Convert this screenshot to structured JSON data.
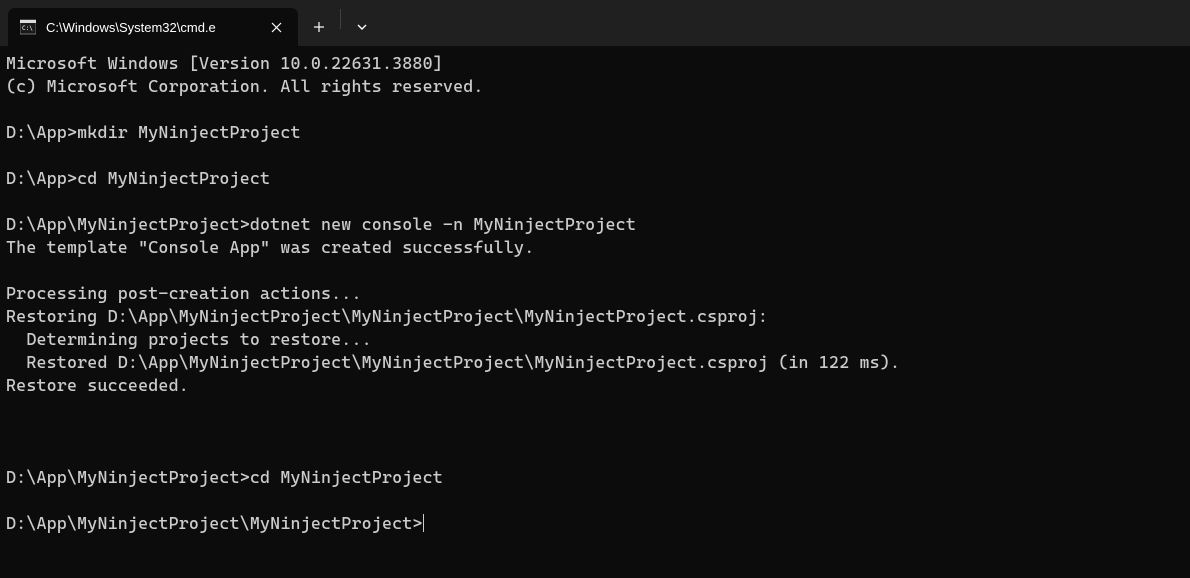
{
  "titlebar": {
    "tab": {
      "title": "C:\\Windows\\System32\\cmd.e",
      "icon": "cmd-icon"
    }
  },
  "terminal": {
    "lines": [
      "Microsoft Windows [Version 10.0.22631.3880]",
      "(c) Microsoft Corporation. All rights reserved.",
      "",
      "D:\\App>mkdir MyNinjectProject",
      "",
      "D:\\App>cd MyNinjectProject",
      "",
      "D:\\App\\MyNinjectProject>dotnet new console -n MyNinjectProject",
      "The template \"Console App\" was created successfully.",
      "",
      "Processing post-creation actions...",
      "Restoring D:\\App\\MyNinjectProject\\MyNinjectProject\\MyNinjectProject.csproj:",
      "  Determining projects to restore...",
      "  Restored D:\\App\\MyNinjectProject\\MyNinjectProject\\MyNinjectProject.csproj (in 122 ms).",
      "Restore succeeded.",
      "",
      "",
      "",
      "D:\\App\\MyNinjectProject>cd MyNinjectProject",
      ""
    ],
    "current_prompt": "D:\\App\\MyNinjectProject\\MyNinjectProject>"
  }
}
